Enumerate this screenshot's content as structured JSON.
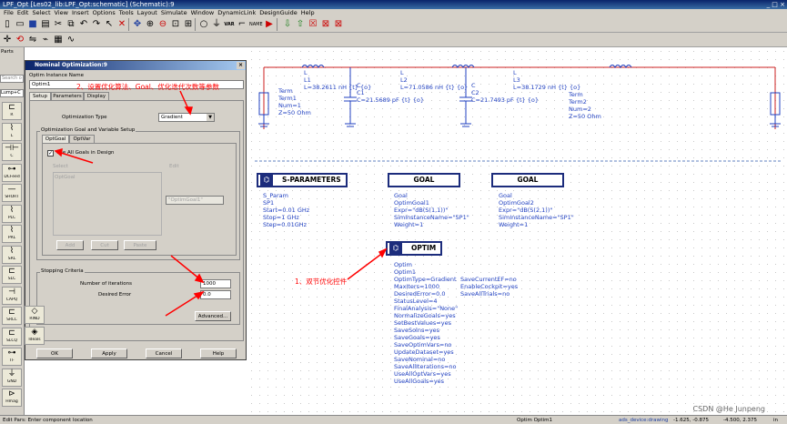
{
  "window": {
    "title": "LPF_Opt [Les02_lib:LPF_Opt:schematic] (Schematic):9",
    "controls": "_ □ ×"
  },
  "menu": [
    "File",
    "Edit",
    "Select",
    "View",
    "Insert",
    "Options",
    "Tools",
    "Layout",
    "Simulate",
    "Window",
    "DynamicLink",
    "DesignGuide",
    "Help"
  ],
  "palette": {
    "title": "Parts",
    "search_placeholder": "Search o",
    "library": "Lump+C",
    "items": [
      {
        "glyph": "⊏",
        "label": "R"
      },
      {
        "glyph": "⌇",
        "label": "L"
      },
      {
        "glyph": "⊣⊢",
        "label": "C"
      },
      {
        "glyph": "⊶",
        "label": "DCFeed"
      },
      {
        "glyph": "—",
        "label": "SHORT"
      },
      {
        "glyph": "⌇",
        "label": "PLC"
      },
      {
        "glyph": "⌇",
        "label": "PRL"
      },
      {
        "glyph": "⌇",
        "label": "SRL"
      },
      {
        "glyph": "⊏",
        "label": "SLC"
      },
      {
        "glyph": "⊣",
        "label": "CAPQ"
      },
      {
        "glyph": "⊏",
        "label": "SRLC"
      },
      {
        "glyph": "⊏",
        "label": "SLCQ"
      },
      {
        "glyph": "⊶",
        "label": "TF"
      },
      {
        "glyph": "⏚",
        "label": "GND"
      },
      {
        "glyph": "⊳",
        "label": "Hmag"
      }
    ],
    "extra_items": [
      {
        "glyph": "◇",
        "label": "RIND"
      },
      {
        "glyph": "◈",
        "label": "Ideals"
      }
    ]
  },
  "dialog": {
    "title": "Nominal Optimization:9",
    "instance_label": "Optim Instance Name",
    "instance_value": "Optim1",
    "tabs": [
      "Setup",
      "Parameters",
      "Display"
    ],
    "type_label": "Optimization Type",
    "type_value": "Gradient",
    "goal_group": "Optimization Goal and Variable Setup",
    "subtabs": [
      "OptGoal",
      "OptVar"
    ],
    "use_all_goals": "Use All Goals in Design",
    "select_label": "Select",
    "edit_label": "Edit",
    "list_header": "OptGoal",
    "goal_option": "\"OptimGoal1\"",
    "add": "Add",
    "cut": "Cut",
    "paste": "Paste",
    "stop_group": "Stopping Criteria",
    "iter_label": "Number of iterations",
    "iter_value": "1000",
    "error_label": "Desired Error",
    "error_value": "0.0",
    "advanced": "Advanced...",
    "ok": "OK",
    "apply": "Apply",
    "cancel": "Cancel",
    "help": "Help"
  },
  "annotations": {
    "a2": "2、设置优化算法、Goal、优化迭代次数等参数",
    "a1": "1、双节优化控件"
  },
  "schematic": {
    "L1": "L\nL1\nL=38.2611 nH {t} {o}",
    "C1": "C\nC1\nC=21.5689 pF {t} {o}",
    "L2": "L\nL2\nL=71.0586 nH {t} {o}",
    "C2": "C\nC2\nC=21.7493 pF {t} {o}",
    "L3": "L\nL3\nL=38.1729 nH {t} {o}",
    "term1": "Term\nTerm1\nNum=1\nZ=50 Ohm",
    "term2": "Term\nTerm2\nNum=2\nZ=50 Ohm",
    "sp_title": "S-PARAMETERS",
    "sp_text": "S_Param\nSP1\nStart=0.01 GHz\nStop=1 GHz\nStep=0.01GHz",
    "goal_title": "GOAL",
    "goal1_text": "Goal\nOptimGoal1\nExpr=\"dB(S(1,1))\"\nSimInstanceName=\"SP1\"\nWeight=1",
    "goal2_text": "Goal\nOptimGoal2\nExpr=\"dB(S(2,1))\"\nSimInstanceName=\"SP1\"\nWeight=1",
    "optim_title": "OPTIM",
    "optim_left": "Optim\nOptim1\nOptimType=Gradient\nMaxIters=1000\nDesiredError=0.0\nStatusLevel=4\nFinalAnalysis=\"None\"\nNormalizeGoals=yes\nSetBestValues=yes\nSaveSolns=yes\nSaveGoals=yes\nSaveOptimVars=no\nUpdateDataset=yes\nSaveNominal=no\nSaveAllIterations=no\nUseAllOptVars=yes\nUseAllGoals=yes",
    "optim_right": "SaveCurrentEF=no\nEnableCockpit=yes\nSaveAllTrials=no"
  },
  "status": {
    "left": "Edit Pars: Enter component location",
    "mid": "Optim Optim1",
    "device": "ads_device:drawing",
    "coords1": "-1.625, -0.875",
    "coords2": "-4.500, 2.375",
    "unit": "in",
    "watermark": "CSDN @He Junpeng"
  },
  "colors": {
    "wire": "#cc2222",
    "component": "#2040c0",
    "annotation": "#ff0000",
    "block_border": "#1c2c7c"
  }
}
